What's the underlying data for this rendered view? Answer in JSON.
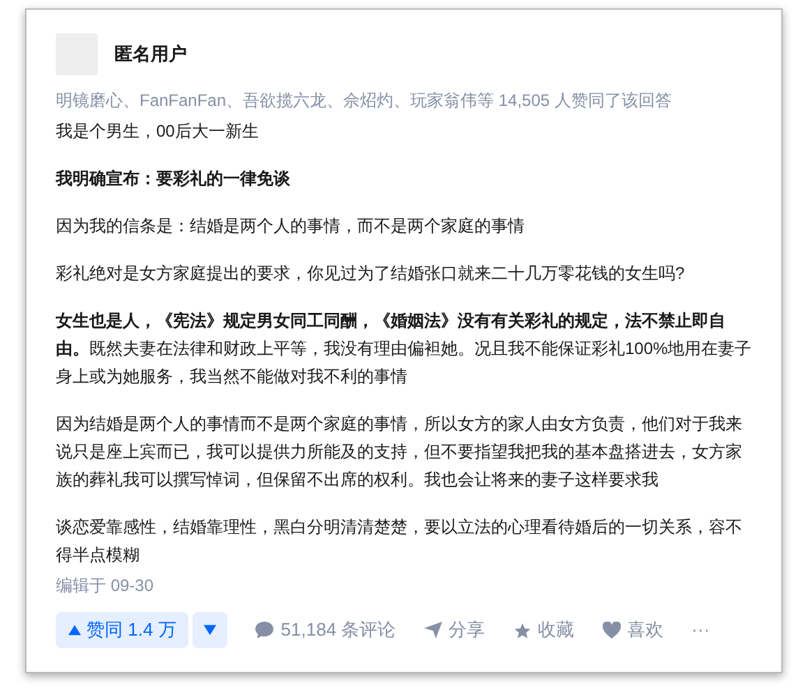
{
  "author": {
    "name": "匿名用户"
  },
  "voters": "明镜磨心、FanFanFan、吾欲揽六龙、佘炤灼、玩家翁伟等 14,505 人赞同了该回答",
  "paragraphs": [
    {
      "text": "我是个男生，00后大一新生",
      "bold": false
    },
    {
      "text": "我明确宣布：要彩礼的一律免谈",
      "bold": true
    },
    {
      "text": "因为我的信条是：结婚是两个人的事情，而不是两个家庭的事情",
      "bold": false
    },
    {
      "text": "彩礼绝对是女方家庭提出的要求，你见过为了结婚张口就来二十几万零花钱的女生吗?",
      "bold": false
    },
    {
      "text": "**女生也是人，《宪法》规定男女同工同酬，《婚姻法》没有有关彩礼的规定，法不禁止即自由。**既然夫妻在法律和财政上平等，我没有理由偏袒她。况且我不能保证彩礼100%地用在妻子身上或为她服务，我当然不能做对我不利的事情",
      "bold": false
    },
    {
      "text": "因为结婚是两个人的事情而不是两个家庭的事情，所以女方的家人由女方负责，他们对于我来说只是座上宾而已，我可以提供力所能及的支持，但不要指望我把我的基本盘搭进去，女方家族的葬礼我可以撰写悼词，但保留不出席的权利。我也会让将来的妻子这样要求我",
      "bold": false
    },
    {
      "text": "谈恋爱靠感性，结婚靠理性，黑白分明清清楚楚，要以立法的心理看待婚后的一切关系，容不得半点模糊",
      "bold": false
    }
  ],
  "edited": "编辑于 09-30",
  "actions": [
    {
      "kind": "upvote",
      "label": "赞同 1.4 万"
    },
    {
      "kind": "downvote"
    },
    {
      "kind": "comment",
      "label": "51,184 条评论"
    },
    {
      "kind": "share",
      "label": "分享"
    },
    {
      "kind": "favorite",
      "label": "收藏"
    },
    {
      "kind": "like",
      "label": "喜欢"
    },
    {
      "kind": "more",
      "label": "···"
    }
  ]
}
